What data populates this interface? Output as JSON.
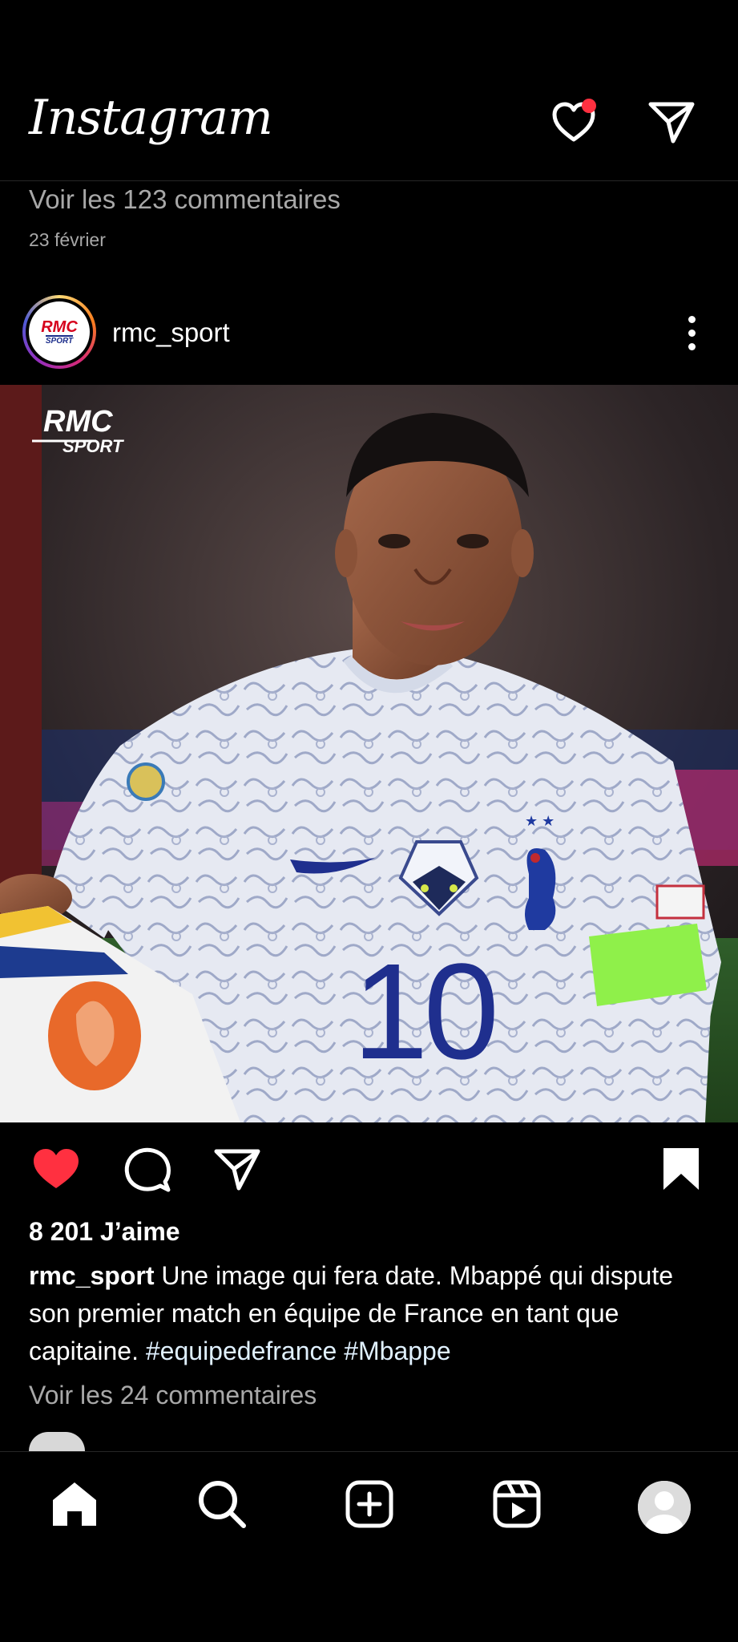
{
  "app": {
    "name": "Instagram",
    "notification_dot_color": "#ff3040"
  },
  "header": {
    "logo_text": "Instagram",
    "icons": [
      "heart-icon",
      "direct-message-icon"
    ]
  },
  "previous_post": {
    "comments_link": "Voir les 123 commentaires",
    "date": "23 février"
  },
  "post": {
    "username": "rmc_sport",
    "avatar_text_top": "RMC",
    "avatar_text_bottom": "SPORT",
    "image": {
      "watermark_top": "RMC",
      "watermark_bottom": "SPORT",
      "jersey_number": "10"
    },
    "liked": true,
    "saved": true,
    "like_color": "#ff3040",
    "likes": "8 201 J’aime",
    "caption_user": "rmc_sport",
    "caption_text": " Une image qui fera date. Mbappé qui dispute son premier match en équipe de France en tant que capitaine. ",
    "hashtags": [
      "#equipedefrance",
      "#Mbappe"
    ],
    "view_comments": "Voir les 24 commentaires"
  },
  "bottom_nav": {
    "items": [
      "home-icon",
      "search-icon",
      "create-icon",
      "reels-icon",
      "profile-avatar"
    ]
  }
}
